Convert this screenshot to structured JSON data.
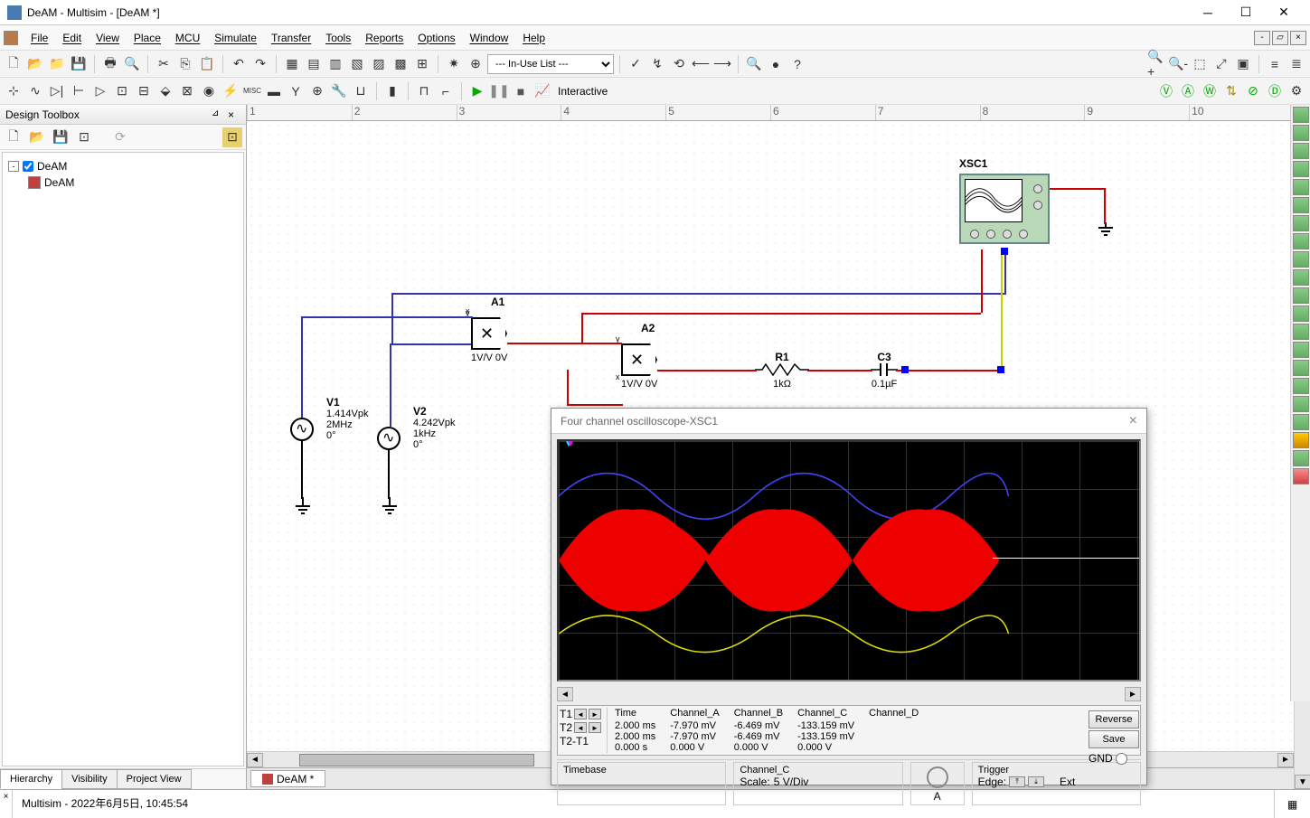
{
  "app": {
    "title": "DeAM - Multisim - [DeAM *]"
  },
  "menu": {
    "items": [
      "File",
      "Edit",
      "View",
      "Place",
      "MCU",
      "Simulate",
      "Transfer",
      "Tools",
      "Reports",
      "Options",
      "Window",
      "Help"
    ]
  },
  "toolbar1": {
    "inuse_combo": "--- In-Use List ---"
  },
  "toolbar2": {
    "interactive_label": "Interactive"
  },
  "toolbox": {
    "title": "Design Toolbox",
    "root": "DeAM",
    "child": "DeAM",
    "tabs": [
      "Hierarchy",
      "Visibility",
      "Project View"
    ],
    "active_tab": 0
  },
  "ruler": {
    "marks": [
      "1",
      "2",
      "3",
      "4",
      "5",
      "6",
      "7",
      "8",
      "9",
      "10"
    ]
  },
  "circuit": {
    "xsc": {
      "label": "XSC1"
    },
    "a1": {
      "name": "A1",
      "val": "1V/V 0V"
    },
    "a2": {
      "name": "A2",
      "val": "1V/V 0V"
    },
    "v1": {
      "name": "V1",
      "line1": "1.414Vpk",
      "line2": "2MHz",
      "line3": "0°"
    },
    "v2": {
      "name": "V2",
      "line1": "4.242Vpk",
      "line2": "1kHz",
      "line3": "0°"
    },
    "r1": {
      "name": "R1",
      "val": "1kΩ"
    },
    "c3": {
      "name": "C3",
      "val": "0.1µF"
    }
  },
  "doc_tab": {
    "label": "DeAM *"
  },
  "log": {
    "text": "Multisim  -  2022年6月5日, 10:45:54"
  },
  "scope": {
    "title": "Four channel oscilloscope-XSC1",
    "cursors": {
      "t1": "T1",
      "t2": "T2",
      "diff": "T2-T1"
    },
    "cols": {
      "time": {
        "hdr": "Time",
        "v1": "2.000 ms",
        "v2": "2.000 ms",
        "v3": "0.000 s"
      },
      "cha": {
        "hdr": "Channel_A",
        "v1": "-7.970 mV",
        "v2": "-7.970 mV",
        "v3": "0.000 V"
      },
      "chb": {
        "hdr": "Channel_B",
        "v1": "-6.469 mV",
        "v2": "-6.469 mV",
        "v3": "0.000 V"
      },
      "chc": {
        "hdr": "Channel_C",
        "v1": "-133.159 mV",
        "v2": "-133.159 mV",
        "v3": "0.000 V"
      },
      "chd": {
        "hdr": "Channel_D",
        "v1": "",
        "v2": "",
        "v3": ""
      }
    },
    "btn_reverse": "Reverse",
    "btn_save": "Save",
    "gnd_label": "GND",
    "panels": {
      "timebase": "Timebase",
      "channel_c": "Channel_C",
      "knob_a": "A",
      "trigger": "Trigger",
      "edge": "Edge:",
      "ext": "Ext",
      "scale": "Scale:",
      "scaleval": "5 V/Div"
    }
  }
}
